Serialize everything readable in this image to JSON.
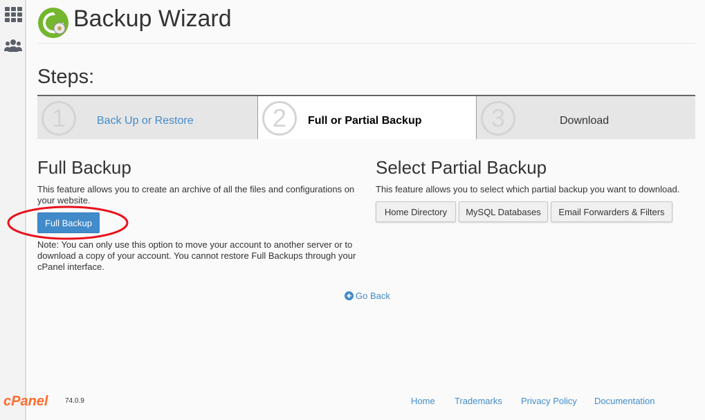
{
  "sidebar": {
    "items": [
      {
        "icon": "apps-grid-icon"
      },
      {
        "icon": "users-icon"
      }
    ]
  },
  "header": {
    "logo_icon": "backup-wizard-icon",
    "title": "Backup Wizard"
  },
  "steps": {
    "title": "Steps:",
    "items": [
      {
        "number": "1",
        "label": "Back Up or Restore",
        "state": "link"
      },
      {
        "number": "2",
        "label": "Full or Partial Backup",
        "state": "active"
      },
      {
        "number": "3",
        "label": "Download",
        "state": "upcoming"
      }
    ]
  },
  "full_backup": {
    "title": "Full Backup",
    "description": "This feature allows you to create an archive of all the files and configurations on your website.",
    "button_label": "Full Backup",
    "note": "Note: You can only use this option to move your account to another server or to download a copy of your account. You cannot restore Full Backups through your cPanel interface."
  },
  "partial_backup": {
    "title": "Select Partial Backup",
    "description": "This feature allows you to select which partial backup you want to download.",
    "buttons": [
      "Home Directory",
      "MySQL Databases",
      "Email Forwarders & Filters"
    ]
  },
  "go_back": "Go Back",
  "footer": {
    "logo_text": "cPanel",
    "version": "74.0.9",
    "links": [
      "Home",
      "Trademarks",
      "Privacy Policy",
      "Documentation"
    ]
  },
  "colors": {
    "link": "#428bca",
    "primary_button": "#428bca",
    "annotation_circle": "#e8111b",
    "brand_orange": "#ff6c2c",
    "logo_green": "#74b72e"
  }
}
